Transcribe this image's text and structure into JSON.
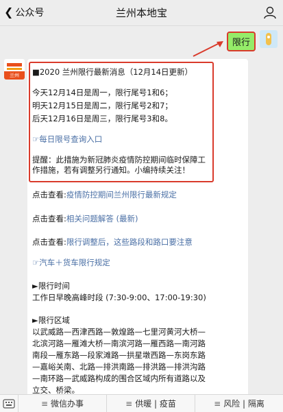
{
  "header": {
    "back_label": "公众号",
    "title": "兰州本地宝"
  },
  "chat": {
    "user_message": "限行",
    "bot_avatar_text": "兰州",
    "highlight": {
      "headline": "■2020 兰州限行最新消息（12月14日更新）",
      "lines": [
        "今天12月14日是周一，限行尾号1和6；",
        "明天12月15日是周二，限行尾号2和7；",
        "后天12月16日是周三，限行尾号3和8。"
      ],
      "query_link": "☞每日限号查询入口",
      "notice": "提醒：此措施为新冠肺炎疫情防控期间临时保障工作措施，若有调整另行通知。小编持续关注！"
    },
    "links": [
      {
        "prefix": "点击查看:",
        "text": "疫情防控期间兰州限行最新规定"
      },
      {
        "prefix": "点击查看:",
        "text": "相关问题解答 (最新)"
      },
      {
        "prefix": "点击查看:",
        "text": "限行调整后，这些路段和路口要注意"
      }
    ],
    "truck_link": "☞汽车＋货车限行规定",
    "time_section": {
      "heading": "►限行时间",
      "body": "工作日早晚高峰时段 (7:30-9:00、17:00-19:30)"
    },
    "area_section": {
      "heading": "►限行区域",
      "lines": [
        "以武威路—西津西路—敦煌路—七里河黄河大桥—",
        "北滨河路—雁滩大桥—南滨河路—雁西路—南河路",
        "南段—雁东路—段家滩路—拱星墩西路—东岗东路",
        "—嘉峪关南、北路—排洪南路—排洪路—排洪沟路",
        "—南环路—武威路构成的围合区域内所有道路以及",
        "立交、桥梁。"
      ]
    }
  },
  "menu": {
    "items": [
      {
        "label": "微信办事"
      },
      {
        "label": "供暖 | 疫苗"
      },
      {
        "label": "风险 | 隔离"
      }
    ]
  }
}
